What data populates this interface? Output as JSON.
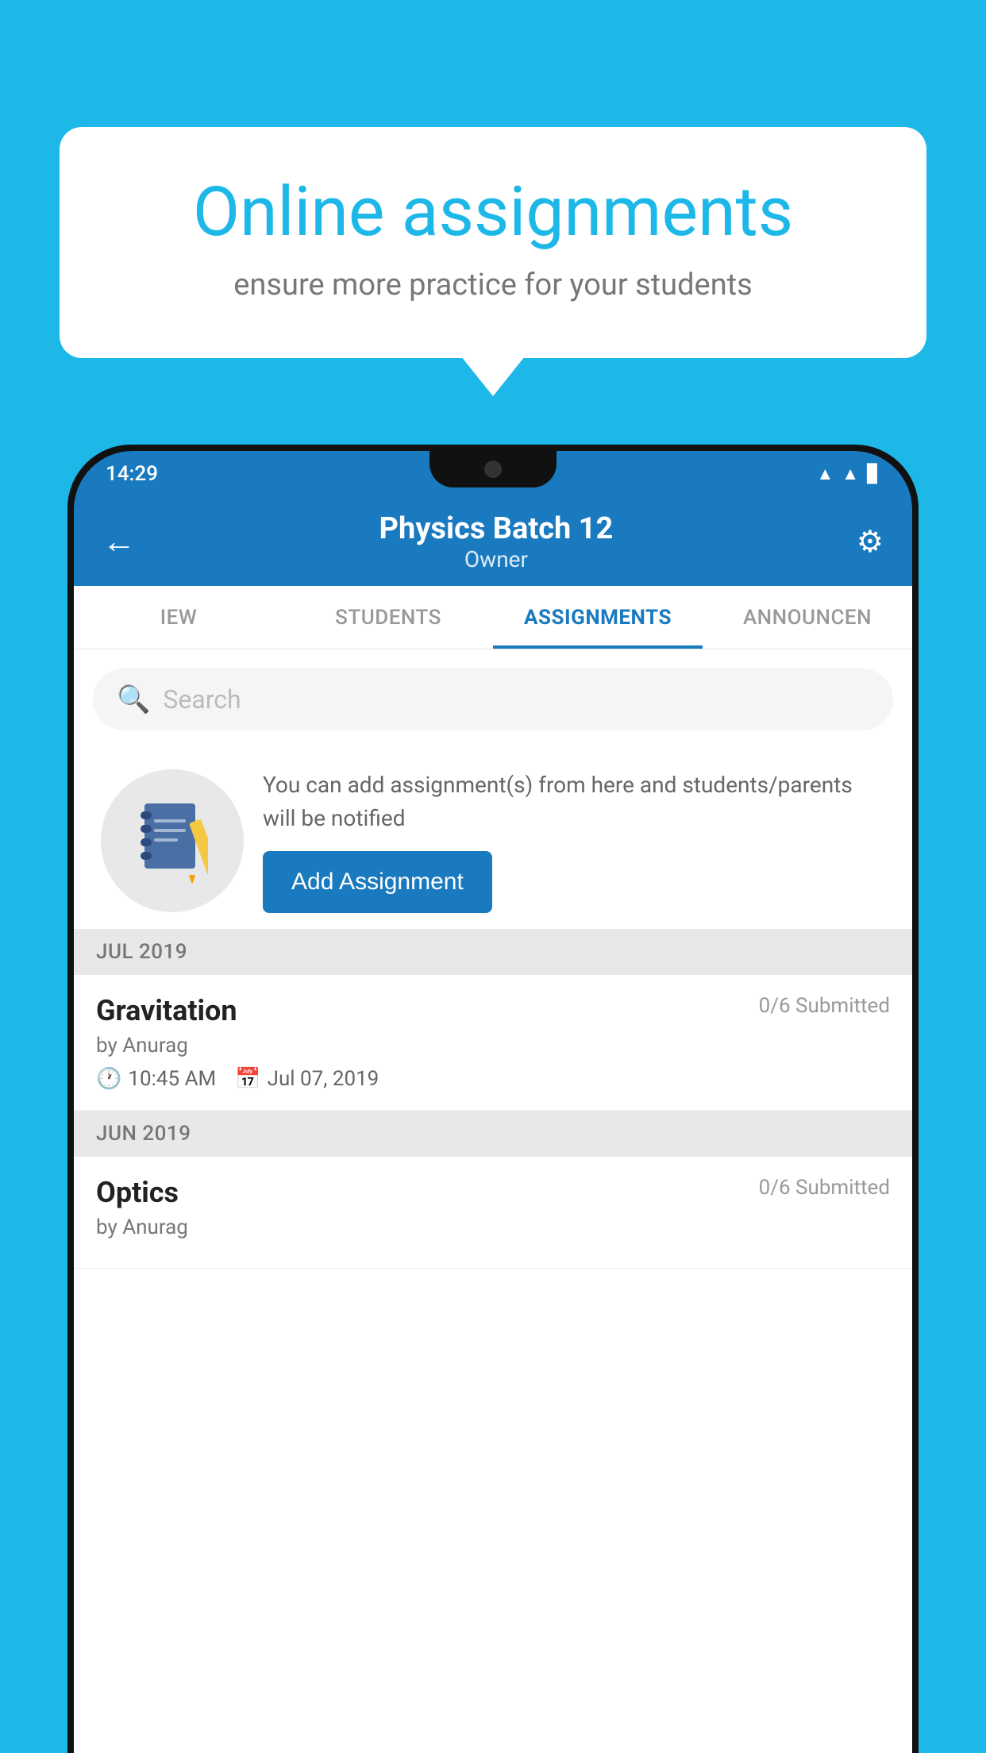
{
  "background_color": "#1db8e8",
  "speech_bubble": {
    "title": "Online assignments",
    "subtitle": "ensure more practice for your students"
  },
  "status_bar": {
    "time": "14:29",
    "icons": [
      "wifi",
      "signal",
      "battery"
    ]
  },
  "app_header": {
    "title": "Physics Batch 12",
    "subtitle": "Owner",
    "back_label": "←",
    "settings_label": "⚙"
  },
  "tabs": [
    {
      "label": "IEW",
      "active": false
    },
    {
      "label": "STUDENTS",
      "active": false
    },
    {
      "label": "ASSIGNMENTS",
      "active": true
    },
    {
      "label": "ANNOUNCEN",
      "active": false
    }
  ],
  "search": {
    "placeholder": "Search"
  },
  "promo": {
    "description": "You can add assignment(s) from here and students/parents will be notified",
    "button_label": "Add Assignment"
  },
  "sections": [
    {
      "label": "JUL 2019",
      "assignments": [
        {
          "name": "Gravitation",
          "submitted": "0/6 Submitted",
          "author": "by Anurag",
          "time": "10:45 AM",
          "date": "Jul 07, 2019"
        }
      ]
    },
    {
      "label": "JUN 2019",
      "assignments": [
        {
          "name": "Optics",
          "submitted": "0/6 Submitted",
          "author": "by Anurag",
          "time": "",
          "date": ""
        }
      ]
    }
  ]
}
